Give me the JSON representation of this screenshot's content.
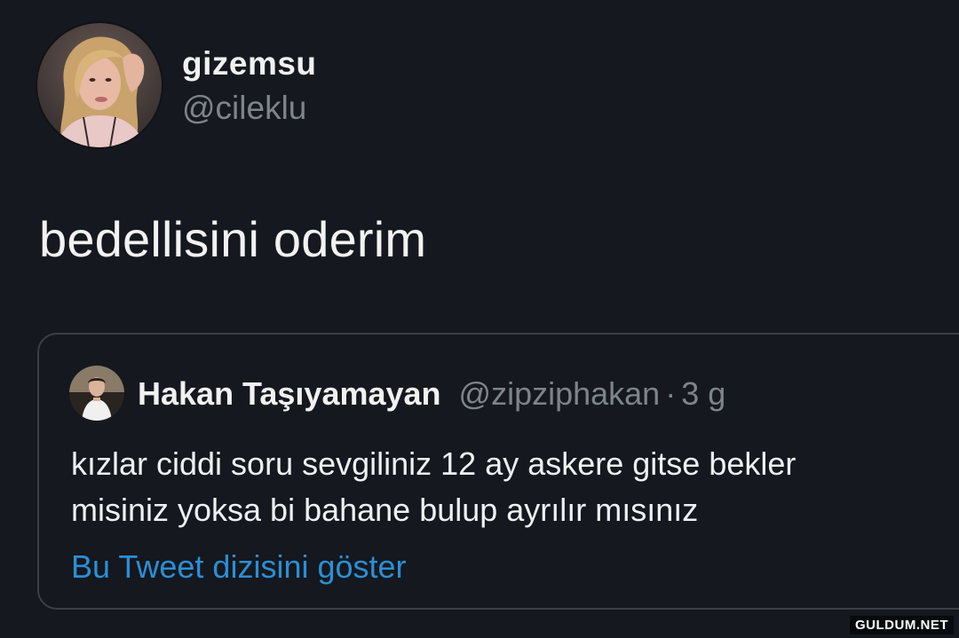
{
  "tweet": {
    "author": {
      "display_name": "gizemsu",
      "handle": "@cileklu",
      "avatar_icon": "profile-photo-avatar"
    },
    "text": "bedellisini oderim"
  },
  "quoted_tweet": {
    "author": {
      "display_name": "Hakan Taşıyamayan",
      "handle": "@zipziphakan",
      "avatar_icon": "profile-photo-avatar"
    },
    "separator": "·",
    "time": "3 g",
    "text_lines": [
      "kızlar ciddi soru sevgiliniz 12 ay askere gitse bekler",
      "misiniz yoksa bi bahane bulup ayrılır mısınız"
    ],
    "thread_link": "Bu Tweet dizisini göster"
  },
  "watermark": "GULDUM.NET",
  "colors": {
    "background": "#15181e",
    "link": "#2b8fd6",
    "secondary_text": "#7d848c",
    "card_border": "#3a3f46"
  }
}
